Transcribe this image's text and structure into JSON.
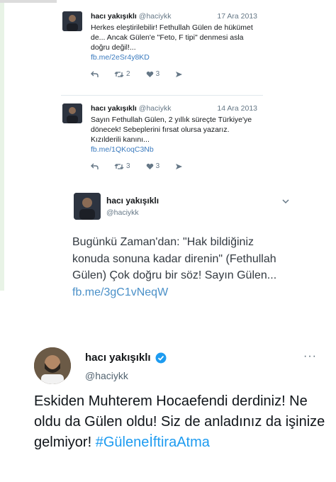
{
  "tweet1": {
    "name": "hacı yakışıklı",
    "handle": "@haciykk",
    "date": "17 Ara 2013",
    "text": "Herkes eleştirilebilir! Fethullah Gülen de hükümet de... Ancak Gülen'e \"Feto, F tipi\" denmesi asla doğru değil!...",
    "link": "fb.me/2eSr4y8KD",
    "retweets": "2",
    "likes": "3"
  },
  "tweet2": {
    "name": "hacı yakışıklı",
    "handle": "@haciykk",
    "date": "14 Ara 2013",
    "text": "Sayın Fethullah Gülen, 2 yıllık süreçte Türkiye'ye dönecek! Sebeplerini fırsat olursa yazarız. Kızılderili kanını...",
    "link": "fb.me/1QKoqC3Nb",
    "retweets": "3",
    "likes": "3"
  },
  "tweet3": {
    "name": "hacı yakışıklı",
    "handle": "@haciykk",
    "text": "Bugünkü Zaman'dan: \"Hak bildiğiniz konuda sonuna kadar direnin\" (Fethullah Gülen) Çok doğru bir söz! Sayın Gülen...",
    "link": "fb.me/3gC1vNeqW"
  },
  "tweet4": {
    "name": "hacı yakışıklı",
    "handle": "@haciykk",
    "text": "Eskiden Muhterem Hocaefendi derdiniz! Ne oldu da Gülen oldu! Siz de anladınız da işinize gelmiyor!",
    "hashtag": "#GüleneİftiraAtma"
  },
  "icons": {
    "reply": "reply-icon",
    "retweet": "retweet-icon",
    "like": "heart-icon",
    "dm": "dm-icon",
    "verified": "verified-badge-icon",
    "chevron": "chevron-down-icon",
    "more": "more-icon"
  },
  "colors": {
    "link_old": "#3b7bbf",
    "link_mid": "#4a90c8",
    "hashtag": "#1d9bf0",
    "verified": "#1d9bf0"
  }
}
